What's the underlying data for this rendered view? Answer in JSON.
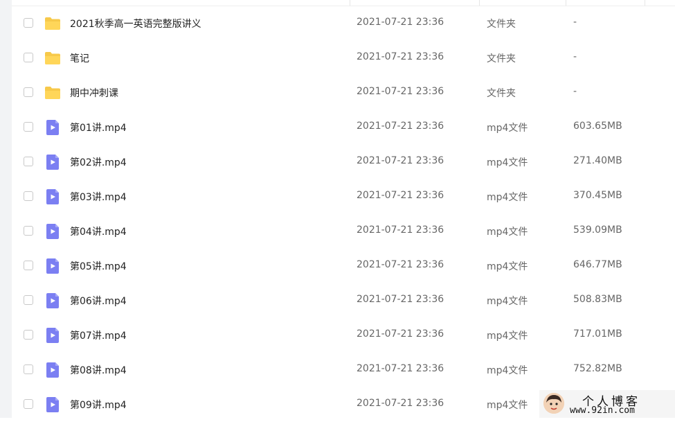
{
  "watermark": {
    "title": "个人博客",
    "url": "www.92in.com"
  },
  "files": [
    {
      "kind": "folder",
      "icon": "folder-icon",
      "name": "2021秋季高一英语完整版讲义",
      "date": "2021-07-21 23:36",
      "type": "文件夹",
      "size": "-"
    },
    {
      "kind": "folder",
      "icon": "folder-icon",
      "name": "笔记",
      "date": "2021-07-21 23:36",
      "type": "文件夹",
      "size": "-"
    },
    {
      "kind": "folder",
      "icon": "folder-icon",
      "name": "期中冲刺课",
      "date": "2021-07-21 23:36",
      "type": "文件夹",
      "size": "-"
    },
    {
      "kind": "video",
      "icon": "video-file-icon",
      "name": "第01讲.mp4",
      "date": "2021-07-21 23:36",
      "type": "mp4文件",
      "size": "603.65MB"
    },
    {
      "kind": "video",
      "icon": "video-file-icon",
      "name": "第02讲.mp4",
      "date": "2021-07-21 23:36",
      "type": "mp4文件",
      "size": "271.40MB"
    },
    {
      "kind": "video",
      "icon": "video-file-icon",
      "name": "第03讲.mp4",
      "date": "2021-07-21 23:36",
      "type": "mp4文件",
      "size": "370.45MB"
    },
    {
      "kind": "video",
      "icon": "video-file-icon",
      "name": "第04讲.mp4",
      "date": "2021-07-21 23:36",
      "type": "mp4文件",
      "size": "539.09MB"
    },
    {
      "kind": "video",
      "icon": "video-file-icon",
      "name": "第05讲.mp4",
      "date": "2021-07-21 23:36",
      "type": "mp4文件",
      "size": "646.77MB"
    },
    {
      "kind": "video",
      "icon": "video-file-icon",
      "name": "第06讲.mp4",
      "date": "2021-07-21 23:36",
      "type": "mp4文件",
      "size": "508.83MB"
    },
    {
      "kind": "video",
      "icon": "video-file-icon",
      "name": "第07讲.mp4",
      "date": "2021-07-21 23:36",
      "type": "mp4文件",
      "size": "717.01MB"
    },
    {
      "kind": "video",
      "icon": "video-file-icon",
      "name": "第08讲.mp4",
      "date": "2021-07-21 23:36",
      "type": "mp4文件",
      "size": "752.82MB"
    },
    {
      "kind": "video",
      "icon": "video-file-icon",
      "name": "第09讲.mp4",
      "date": "2021-07-21 23:36",
      "type": "mp4文件",
      "size": ""
    }
  ]
}
